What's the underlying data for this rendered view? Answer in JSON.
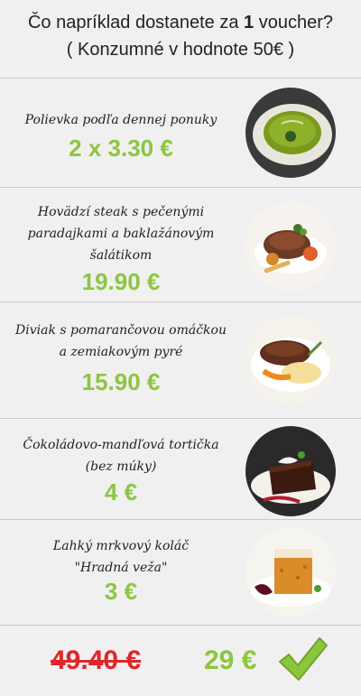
{
  "header": {
    "line1_before": "Čo napríklad dostanete za ",
    "line1_bold": "1",
    "line1_after": " voucher?",
    "line2": "( Konzumné v hodnote 50€ )"
  },
  "items": [
    {
      "name_lines": [
        "Polievka podľa dennej ponuky"
      ],
      "price": "2 x 3.30 €",
      "image": "pea-soup-icon"
    },
    {
      "name_lines": [
        "Hovädzí steak s pečenými",
        "paradajkami a baklažánovým",
        "šalátikom"
      ],
      "price": "19.90 €",
      "image": "beef-steak-icon"
    },
    {
      "name_lines": [
        "Diviak s pomarančovou omáčkou",
        "a zemiakovým pyré"
      ],
      "price": "15.90 €",
      "image": "boar-dish-icon"
    },
    {
      "name_lines": [
        "Čokoládovo-mandľová tortička",
        "(bez múky)"
      ],
      "price": "4 €",
      "image": "chocolate-cake-icon"
    },
    {
      "name_lines": [
        "Ľahký mrkvový koláč",
        "\"Hradná veža\""
      ],
      "price": "3 €",
      "image": "carrot-cake-icon"
    }
  ],
  "footer": {
    "old_price": "49.40 €",
    "new_price": "29 €",
    "check_icon": "checkmark-icon"
  },
  "colors": {
    "price_green": "#8cc63f",
    "old_price_red": "#e0262b",
    "background": "#f0f0f0"
  }
}
